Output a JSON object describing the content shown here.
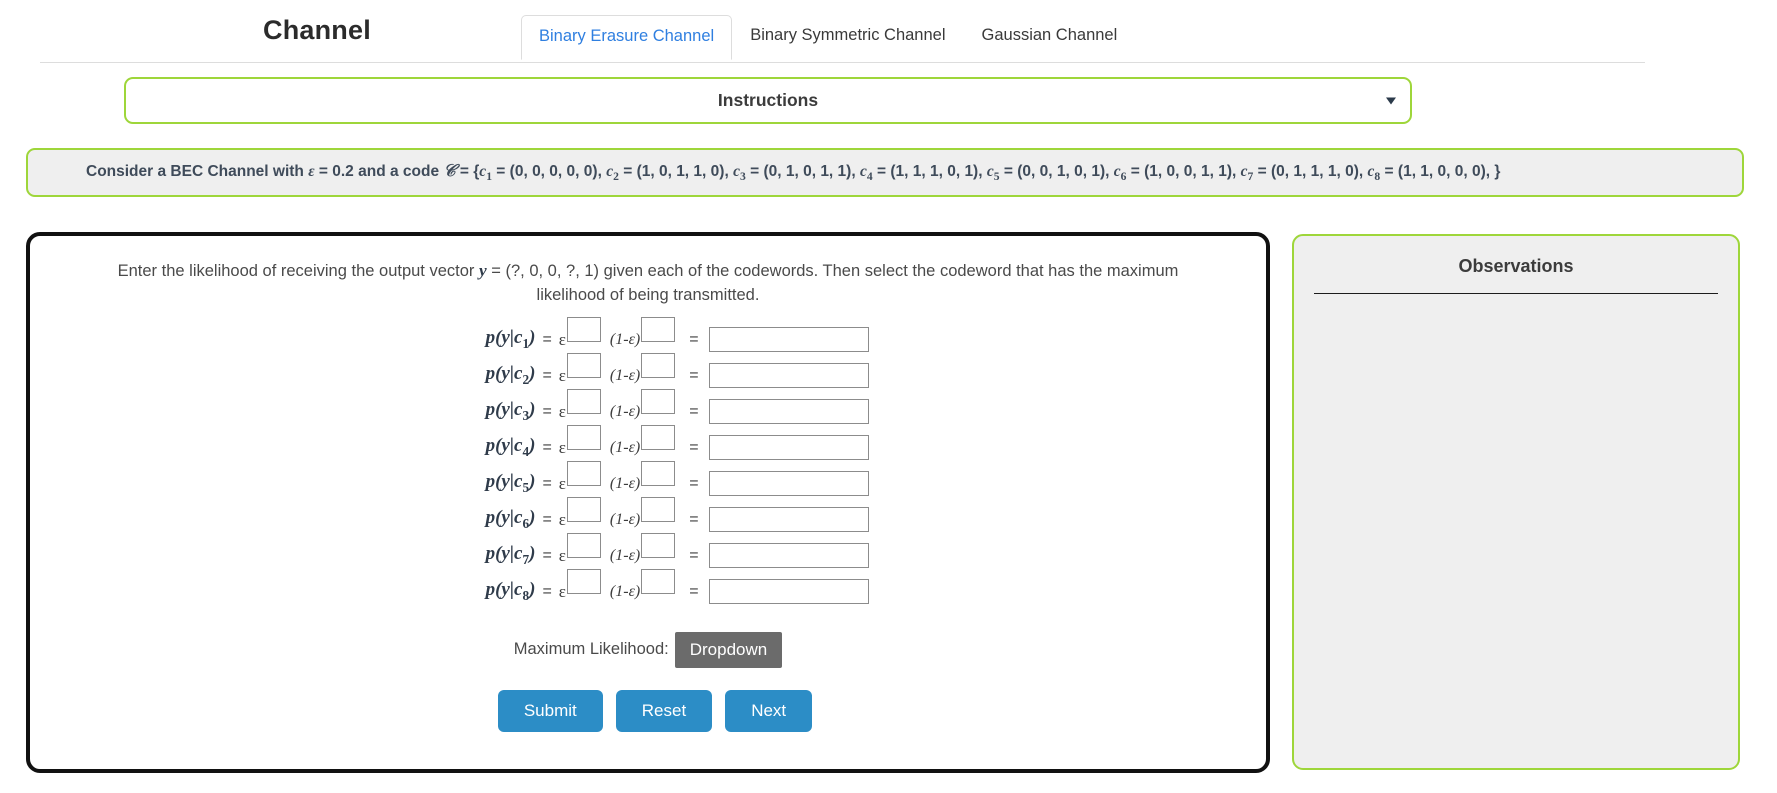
{
  "header": {
    "app_title": "Channel",
    "tabs": [
      {
        "label": "Binary Erasure Channel",
        "active": true
      },
      {
        "label": "Binary Symmetric Channel",
        "active": false
      },
      {
        "label": "Gaussian Channel",
        "active": false
      }
    ]
  },
  "instructions": {
    "title": "Instructions",
    "caret_icon": "chevron-down-icon",
    "expanded": false
  },
  "problem": {
    "prefix": "Consider a BEC Channel with ",
    "epsilon_symbol": "ε",
    "epsilon_value": "0.2",
    "middle": " and a code ",
    "code_symbol": "𝒞",
    "open_brace": " = {",
    "close_brace": "}",
    "codewords": [
      {
        "name": "c",
        "index": "1",
        "value": "(0, 0, 0, 0, 0)"
      },
      {
        "name": "c",
        "index": "2",
        "value": "(1, 0, 1, 1, 0)"
      },
      {
        "name": "c",
        "index": "3",
        "value": "(0, 1, 0, 1, 1)"
      },
      {
        "name": "c",
        "index": "4",
        "value": "(1, 1, 1, 0, 1)"
      },
      {
        "name": "c",
        "index": "5",
        "value": "(0, 0, 1, 0, 1)"
      },
      {
        "name": "c",
        "index": "6",
        "value": "(1, 0, 0, 1, 1)"
      },
      {
        "name": "c",
        "index": "7",
        "value": "(0, 1, 1, 1, 0)"
      },
      {
        "name": "c",
        "index": "8",
        "value": "(1, 1, 0, 0, 0)"
      }
    ],
    "full_text": "Consider a BEC Channel with ε = 0.2 and a code 𝒞 = {c1 = (0, 0, 0, 0, 0), c2 = (1, 0, 1, 1, 0), c3 = (0, 1, 0, 1, 1), c4 = (1, 1, 1, 0, 1), c5 = (0, 0, 1, 0, 1), c6 = (1, 0, 0, 1, 1), c7 = (0, 1, 1, 1, 0), c8 = (1, 1, 0, 0, 0), }"
  },
  "main": {
    "question_part1": "Enter the likelihood of receiving the output vector ",
    "question_y": "y",
    "question_part2": " = (?, 0, 0, ?, 1) given each of the codewords. Then select the codeword that has the maximum likelihood of being transmitted.",
    "received_vector": "(?, 0, 0, ?, 1)",
    "equations": [
      {
        "label_p": "p(y|c",
        "index": "1",
        "label_close": ")",
        "eq": "=",
        "eps": "ε",
        "exp1_value": "",
        "one_minus_eps": "(1-ε)",
        "exp2_value": "",
        "eq2": "=",
        "result_value": ""
      },
      {
        "label_p": "p(y|c",
        "index": "2",
        "label_close": ")",
        "eq": "=",
        "eps": "ε",
        "exp1_value": "",
        "one_minus_eps": "(1-ε)",
        "exp2_value": "",
        "eq2": "=",
        "result_value": ""
      },
      {
        "label_p": "p(y|c",
        "index": "3",
        "label_close": ")",
        "eq": "=",
        "eps": "ε",
        "exp1_value": "",
        "one_minus_eps": "(1-ε)",
        "exp2_value": "",
        "eq2": "=",
        "result_value": ""
      },
      {
        "label_p": "p(y|c",
        "index": "4",
        "label_close": ")",
        "eq": "=",
        "eps": "ε",
        "exp1_value": "",
        "one_minus_eps": "(1-ε)",
        "exp2_value": "",
        "eq2": "=",
        "result_value": ""
      },
      {
        "label_p": "p(y|c",
        "index": "5",
        "label_close": ")",
        "eq": "=",
        "eps": "ε",
        "exp1_value": "",
        "one_minus_eps": "(1-ε)",
        "exp2_value": "",
        "eq2": "=",
        "result_value": ""
      },
      {
        "label_p": "p(y|c",
        "index": "6",
        "label_close": ")",
        "eq": "=",
        "eps": "ε",
        "exp1_value": "",
        "one_minus_eps": "(1-ε)",
        "exp2_value": "",
        "eq2": "=",
        "result_value": ""
      },
      {
        "label_p": "p(y|c",
        "index": "7",
        "label_close": ")",
        "eq": "=",
        "eps": "ε",
        "exp1_value": "",
        "one_minus_eps": "(1-ε)",
        "exp2_value": "",
        "eq2": "=",
        "result_value": ""
      },
      {
        "label_p": "p(y|c",
        "index": "8",
        "label_close": ")",
        "eq": "=",
        "eps": "ε",
        "exp1_value": "",
        "one_minus_eps": "(1-ε)",
        "exp2_value": "",
        "eq2": "=",
        "result_value": ""
      }
    ],
    "max_likelihood_label": "Maximum Likelihood:",
    "max_likelihood_selected": "Dropdown",
    "buttons": {
      "submit": "Submit",
      "reset": "Reset",
      "next": "Next"
    }
  },
  "observations": {
    "title": "Observations",
    "body": ""
  },
  "colors": {
    "accent_green": "#9ed63a",
    "tab_active_text": "#2f7fe0",
    "button_blue": "#2c8dc6",
    "dropdown_gray": "#6b6b6b",
    "panel_gray": "#efefef",
    "panel_border_black": "#111111"
  }
}
